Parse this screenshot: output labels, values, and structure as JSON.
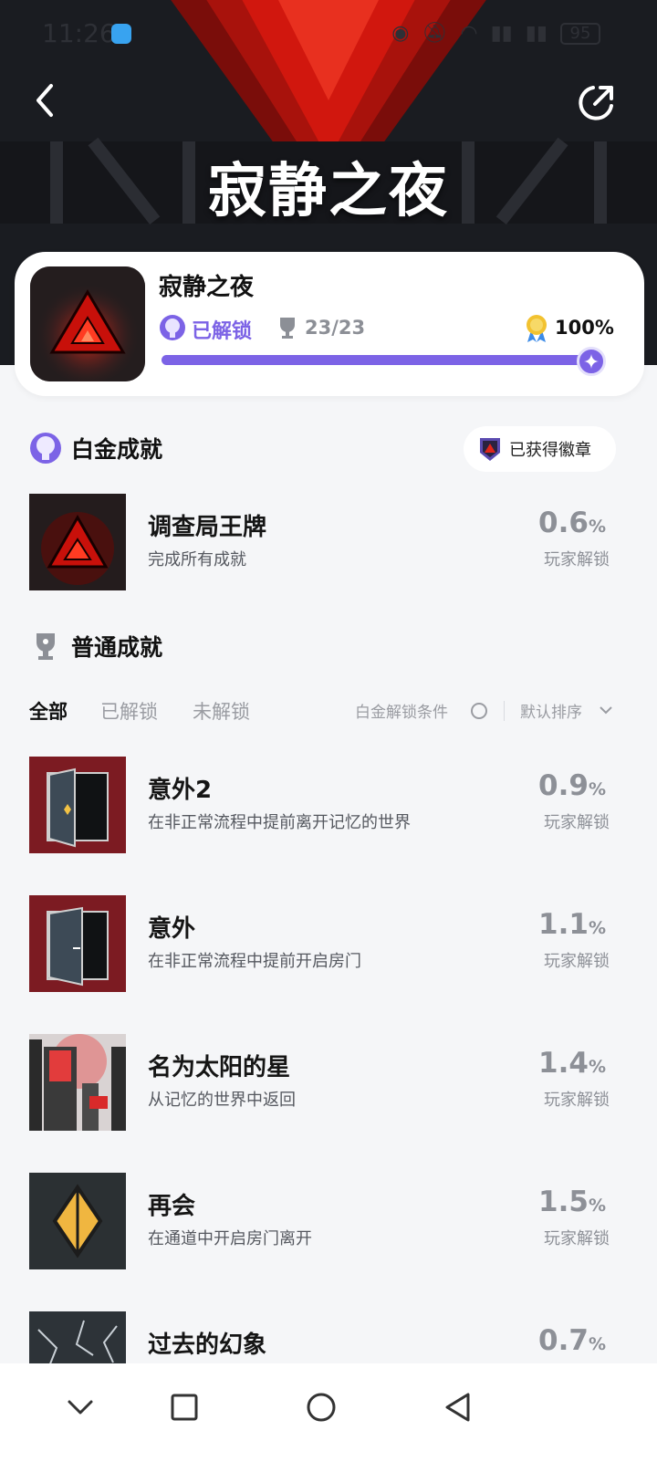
{
  "status": {
    "time": "11:26",
    "battery": "95"
  },
  "hero": {
    "title": "寂静之夜"
  },
  "game": {
    "name": "寂静之夜",
    "unlock_status": "已解锁",
    "trophy_count": "23/23",
    "completion": "100%",
    "progress": 1.0
  },
  "platinum": {
    "section_title": "白金成就",
    "badge_button": "已获得徽章",
    "item": {
      "title": "调查局王牌",
      "desc": "完成所有成就",
      "pct": "0.6",
      "pct_unit": "%",
      "label": "玩家解锁"
    }
  },
  "normal": {
    "section_title": "普通成就",
    "tabs": [
      "全部",
      "已解锁",
      "未解锁"
    ],
    "filter_label": "白金解锁条件",
    "sort_label": "默认排序",
    "items": [
      {
        "title": "意外2",
        "desc": "在非正常流程中提前离开记忆的世界",
        "pct": "0.9",
        "pct_unit": "%",
        "label": "玩家解锁"
      },
      {
        "title": "意外",
        "desc": "在非正常流程中提前开启房门",
        "pct": "1.1",
        "pct_unit": "%",
        "label": "玩家解锁"
      },
      {
        "title": "名为太阳的星",
        "desc": "从记忆的世界中返回",
        "pct": "1.4",
        "pct_unit": "%",
        "label": "玩家解锁"
      },
      {
        "title": "再会",
        "desc": "在通道中开启房门离开",
        "pct": "1.5",
        "pct_unit": "%",
        "label": "玩家解锁"
      },
      {
        "title": "过去的幻象",
        "desc": "",
        "pct": "0.7",
        "pct_unit": "%",
        "label": ""
      }
    ]
  },
  "colors": {
    "accent": "#7c63e6",
    "hero_red": "#d1170e",
    "muted": "#8d9097"
  }
}
